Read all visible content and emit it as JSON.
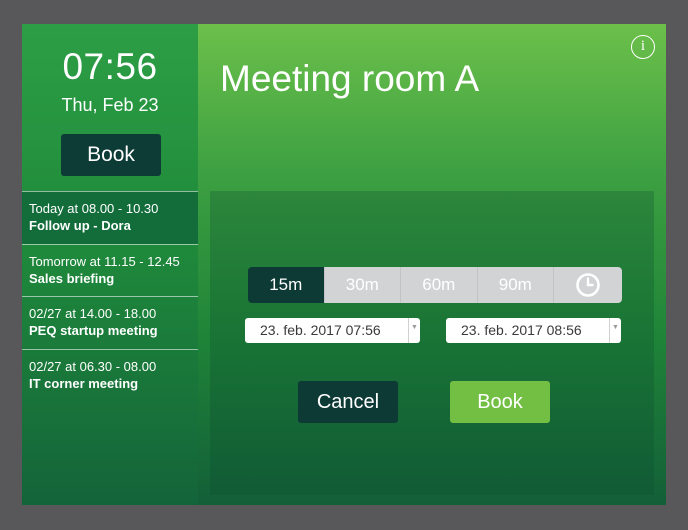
{
  "sidebar": {
    "clock": "07:56",
    "date": "Thu, Feb 23",
    "book_label": "Book",
    "meetings": [
      {
        "time": "Today at 08.00 - 10.30",
        "title": "Follow up - Dora"
      },
      {
        "time": "Tomorrow at 11.15 - 12.45",
        "title": "Sales briefing"
      },
      {
        "time": "02/27 at 14.00 - 18.00",
        "title": "PEQ startup meeting"
      },
      {
        "time": "02/27 at 06.30 - 08.00",
        "title": "IT corner meeting"
      }
    ]
  },
  "main": {
    "title": "Meeting room A",
    "info_icon": "i",
    "durations": [
      "15m",
      "30m",
      "60m",
      "90m"
    ],
    "selected_duration": "15m",
    "start": "23. feb. 2017 07:56",
    "end": "23. feb. 2017 08:56",
    "cancel_label": "Cancel",
    "book_label": "Book"
  },
  "colors": {
    "bezel": "#58585a",
    "dark_teal": "#0e3a36",
    "accent_green": "#72bf44",
    "segment_gray": "#d1d3d4"
  }
}
